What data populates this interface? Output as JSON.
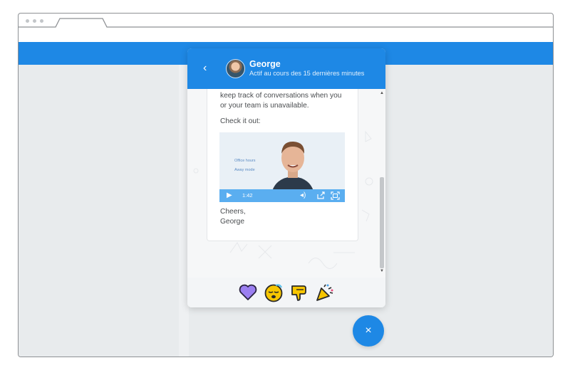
{
  "messenger": {
    "header": {
      "back_icon": "chevron-left-icon",
      "name": "George",
      "status": "Actif au cours des 15 dernières minutes"
    },
    "message": {
      "line1": "keep track of conversations when you",
      "line2": "or your team is unavailable.",
      "line3": "Check it out:",
      "signoff1": "Cheers,",
      "signoff2": "George"
    },
    "video": {
      "label1": "Office hours",
      "label2": "Away mode",
      "time": "1:42"
    },
    "reactions": [
      "heart-icon",
      "sleepy-face-icon",
      "thumbs-down-icon",
      "party-popper-icon"
    ]
  },
  "close_button": {
    "label": "×"
  },
  "colors": {
    "brand": "#1e88e5",
    "heart": "#9b7ff0",
    "emoji_yellow": "#f7c600"
  }
}
